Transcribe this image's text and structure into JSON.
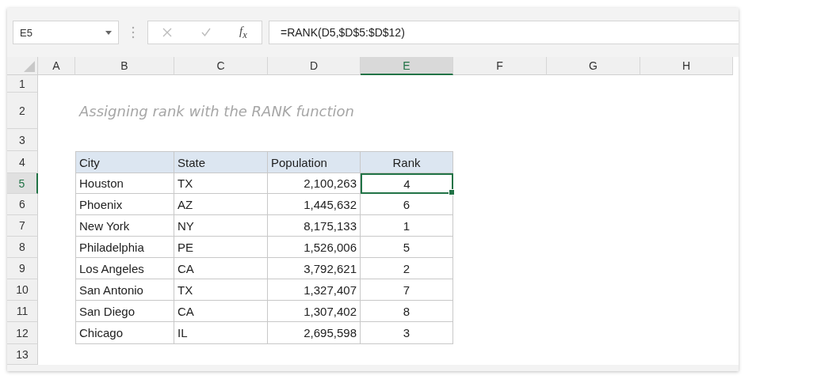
{
  "name_box": {
    "value": "E5"
  },
  "formula_bar": {
    "function_label": "f$_{x}$",
    "formula": "=RANK(D5,$D$5:$D$12)"
  },
  "columns": [
    {
      "label": "A",
      "selected": false
    },
    {
      "label": "B",
      "selected": false
    },
    {
      "label": "C",
      "selected": false
    },
    {
      "label": "D",
      "selected": false
    },
    {
      "label": "E",
      "selected": true
    },
    {
      "label": "F",
      "selected": false
    },
    {
      "label": "G",
      "selected": false
    },
    {
      "label": "H",
      "selected": false
    }
  ],
  "rows": [
    {
      "label": "1",
      "selected": false
    },
    {
      "label": "2",
      "selected": false
    },
    {
      "label": "3",
      "selected": false
    },
    {
      "label": "4",
      "selected": false
    },
    {
      "label": "5",
      "selected": true
    },
    {
      "label": "6",
      "selected": false
    },
    {
      "label": "7",
      "selected": false
    },
    {
      "label": "8",
      "selected": false
    },
    {
      "label": "9",
      "selected": false
    },
    {
      "label": "10",
      "selected": false
    },
    {
      "label": "11",
      "selected": false
    },
    {
      "label": "12",
      "selected": false
    },
    {
      "label": "13",
      "selected": false
    }
  ],
  "title": "Assigning rank with the RANK function",
  "table": {
    "columns": [
      {
        "label": "City",
        "kind": "text"
      },
      {
        "label": "State",
        "kind": "text"
      },
      {
        "label": "Population",
        "kind": "number"
      },
      {
        "label": "Rank",
        "kind": "rank"
      }
    ],
    "rows": [
      {
        "cells": [
          "Houston",
          "TX",
          "2,100,263",
          "4"
        ],
        "selected": true
      },
      {
        "cells": [
          "Phoenix",
          "AZ",
          "1,445,632",
          "6"
        ],
        "selected": false
      },
      {
        "cells": [
          "New York",
          "NY",
          "8,175,133",
          "1"
        ],
        "selected": false
      },
      {
        "cells": [
          "Philadelphia",
          "PE",
          "1,526,006",
          "5"
        ],
        "selected": false
      },
      {
        "cells": [
          "Los Angeles",
          "CA",
          "3,792,621",
          "2"
        ],
        "selected": false
      },
      {
        "cells": [
          "San Antonio",
          "TX",
          "1,327,407",
          "7"
        ],
        "selected": false
      },
      {
        "cells": [
          "San Diego",
          "CA",
          "1,307,402",
          "8"
        ],
        "selected": false
      },
      {
        "cells": [
          "Chicago",
          "IL",
          "2,695,598",
          "3"
        ],
        "selected": false
      }
    ]
  }
}
